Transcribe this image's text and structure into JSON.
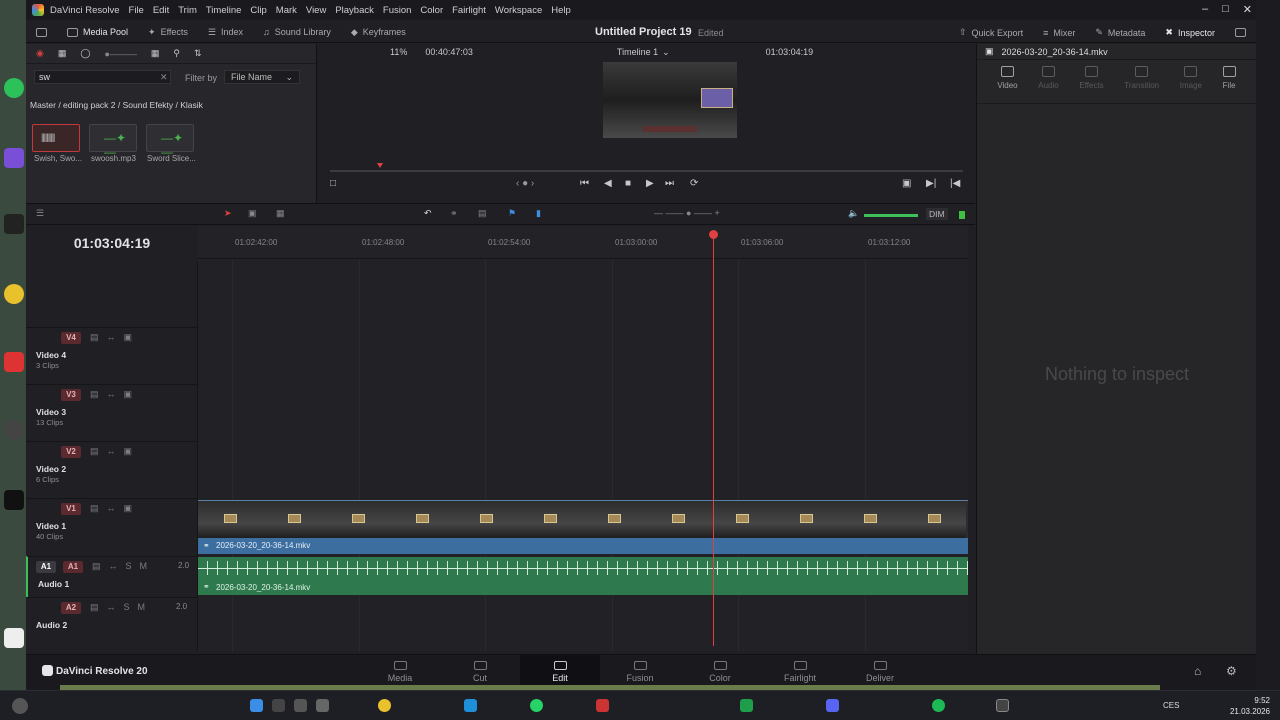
{
  "app": {
    "name": "DaVinci Resolve",
    "menus": [
      "File",
      "Edit",
      "Trim",
      "Timeline",
      "Clip",
      "Mark",
      "View",
      "Playback",
      "Fusion",
      "Color",
      "Fairlight",
      "Workspace",
      "Help"
    ],
    "project_title": "Untitled Project 19",
    "project_status": "Edited"
  },
  "toolbar": {
    "media_pool": "Media Pool",
    "effects": "Effects",
    "index": "Index",
    "sound_library": "Sound Library",
    "keyframes": "Keyframes",
    "quick_export": "Quick Export",
    "mixer": "Mixer",
    "metadata": "Metadata",
    "inspector": "Inspector"
  },
  "media_pool": {
    "search_value": "sw",
    "filter_by_label": "Filter by",
    "filter_value": "File Name",
    "breadcrumb": "Master / editing pack 2 / Sound Efekty / Klasik",
    "clips": [
      {
        "name": "Swish, Swo..."
      },
      {
        "name": "swoosh.mp3"
      },
      {
        "name": "Sword Slice..."
      }
    ]
  },
  "viewer": {
    "zoom": "11%",
    "source_timecode": "00:40:47:03",
    "timeline_name": "Timeline 1",
    "record_timecode": "01:03:04:19"
  },
  "inspector": {
    "file_name": "2026-03-20_20-36-14.mkv",
    "tabs": [
      "Video",
      "Audio",
      "Effects",
      "Transition",
      "Image",
      "File"
    ],
    "empty_message": "Nothing to inspect"
  },
  "timeline": {
    "timecode": "01:03:04:19",
    "dim_label": "DIM",
    "ruler_ticks": [
      "01:02:42:00",
      "01:02:48:00",
      "01:02:54:00",
      "01:03:00:00",
      "01:03:06:00",
      "01:03:12:00"
    ],
    "tracks": [
      {
        "id": "V4",
        "name": "Video 4",
        "sub": "3 Clips"
      },
      {
        "id": "V3",
        "name": "Video 3",
        "sub": "13 Clips"
      },
      {
        "id": "V2",
        "name": "Video 2",
        "sub": "6 Clips"
      },
      {
        "id": "V1",
        "name": "Video 1",
        "sub": "40 Clips"
      },
      {
        "id": "A1",
        "name": "Audio 1",
        "sub": "",
        "vol": "2.0"
      },
      {
        "id": "A2",
        "name": "Audio 2",
        "sub": "",
        "vol": "2.0"
      }
    ],
    "video_clip_name": "2026-03-20_20-36-14.mkv",
    "audio_clip_name": "2026-03-20_20-36-14.mkv"
  },
  "pages": [
    "Media",
    "Cut",
    "Edit",
    "Fusion",
    "Color",
    "Fairlight",
    "Deliver"
  ],
  "brand_label": "DaVinci Resolve 20",
  "taskbar": {
    "lang": "CES",
    "time": "9:52",
    "date": "21.03.2026"
  }
}
